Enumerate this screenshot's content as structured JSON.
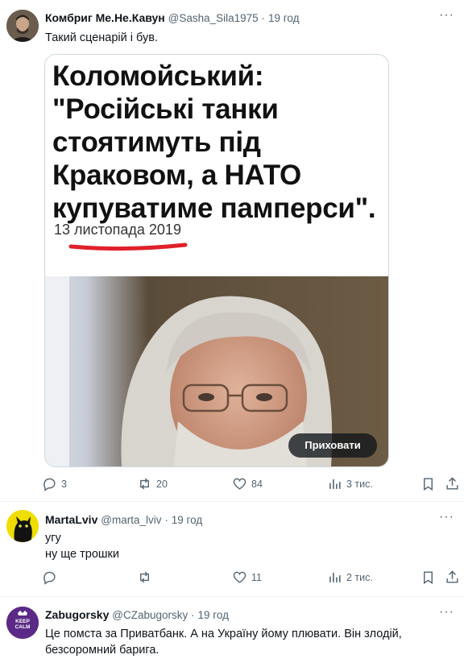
{
  "tweets": [
    {
      "name": "Комбриг Ме.Не.Кавун",
      "handle": "@Sasha_Sila1975",
      "separator": "·",
      "time": "19 год",
      "text": [
        "Такий сценарій і був."
      ],
      "media": {
        "headline": [
          "Коломойський:",
          "\"Російські танки",
          "стоятимуть під",
          "Краковом, а НАТО",
          "купуватиме памперси\"."
        ],
        "date": "13 листопада 2019",
        "hide_label": "Приховати"
      },
      "stats": {
        "replies": "3",
        "retweets": "20",
        "likes": "84",
        "views": "3 тис."
      }
    },
    {
      "name": "MartaLviv",
      "handle": "@marta_lviv",
      "separator": "·",
      "time": "19 год",
      "text": [
        "угу",
        "ну ще трошки"
      ],
      "stats": {
        "replies": "",
        "retweets": "",
        "likes": "11",
        "views": "2 тис."
      }
    },
    {
      "name": "Zabugorsky",
      "handle": "@CZabugorsky",
      "separator": "·",
      "time": "19 год",
      "text": [
        "Це помста за Приватбанк. А на Україну йому плювати. Він злодій,",
        "безсоромний барига."
      ],
      "avatar_text": [
        "KEEP",
        "CALM"
      ]
    }
  ],
  "icons": [
    "more-icon",
    "reply-icon",
    "retweet-icon",
    "like-icon",
    "views-icon",
    "bookmark-icon",
    "share-icon"
  ],
  "colors": {
    "text": "#0f1419",
    "muted": "#536471",
    "divider": "#eff3f4",
    "underline": "#e0202a",
    "avatar_purple": "#5b2a86"
  }
}
